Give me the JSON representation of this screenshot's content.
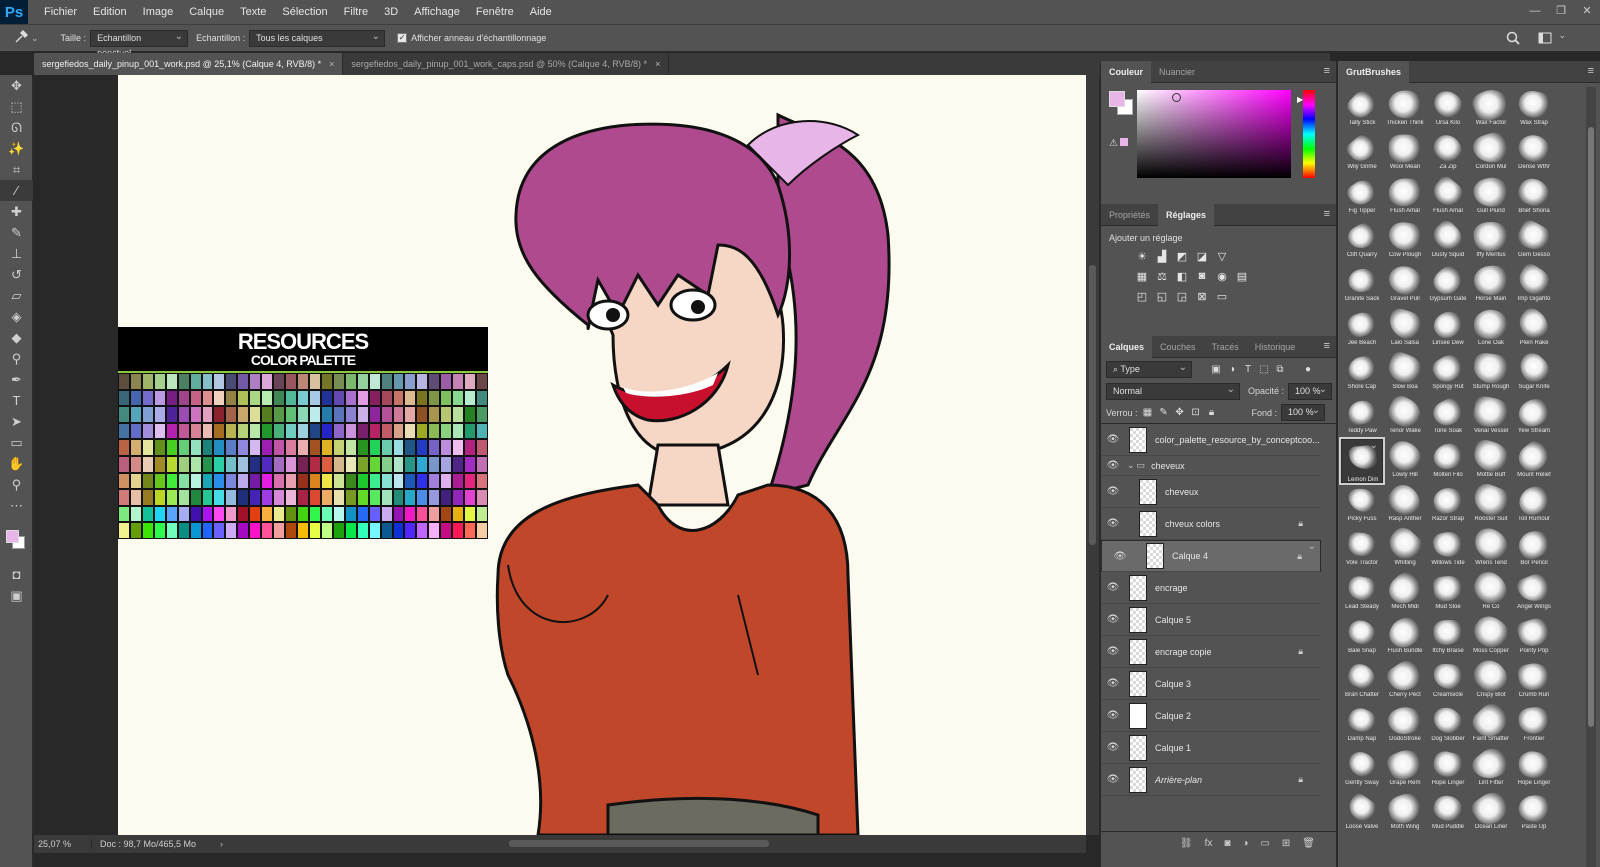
{
  "app": {
    "logo": "Ps"
  },
  "menu": [
    "Fichier",
    "Edition",
    "Image",
    "Calque",
    "Texte",
    "Sélection",
    "Filtre",
    "3D",
    "Affichage",
    "Fenêtre",
    "Aide"
  ],
  "window_controls": [
    "—",
    "❐",
    "✕"
  ],
  "options": {
    "tool_icon": "eyedropper-icon",
    "size_label": "Taille :",
    "size_value": "Echantillon ponctuel",
    "sample_label": "Echantillon :",
    "sample_value": "Tous les calques",
    "ring_checked": true,
    "ring_label": "Afficher anneau d'échantillonnage"
  },
  "tabs": [
    {
      "label": "sergefiedos_daily_pinup_001_work.psd @ 25,1% (Calque 4, RVB/8) *",
      "active": true
    },
    {
      "label": "sergefiedos_daily_pinup_001_work_caps.psd @ 50% (Calque 4, RVB/8) *",
      "active": false
    }
  ],
  "tools": [
    "move",
    "marquee",
    "lasso",
    "wand",
    "crop",
    "eyedropper",
    "heal",
    "brush",
    "stamp",
    "history",
    "eraser",
    "bucket",
    "blur",
    "dodge",
    "pen",
    "type",
    "select",
    "shape",
    "hand",
    "zoom",
    "more"
  ],
  "canvas": {
    "palette_title": "RESOURCES",
    "palette_subtitle": "COLOR PALETTE"
  },
  "status": {
    "zoom": "25,07 %",
    "doc": "Doc : 98,7 Mo/465,5 Mo"
  },
  "color_panel": {
    "tabs": [
      "Couleur",
      "Nuancier"
    ],
    "fg": "#e8b5e8",
    "bg": "#ffffff"
  },
  "adjust_panel": {
    "tabs": [
      "Propriétés",
      "Réglages"
    ],
    "title": "Ajouter un réglage"
  },
  "layers_panel": {
    "tabs": [
      "Calques",
      "Couches",
      "Tracés",
      "Historique"
    ],
    "filter": "Type",
    "blend": "Normal",
    "opacity_label": "Opacité :",
    "opacity": "100 %",
    "lock_label": "Verrou :",
    "fill_label": "Fond :",
    "fill": "100 %",
    "layers": [
      {
        "name": "color_palette_resource_by_conceptcoo...",
        "indent": 0,
        "type": "layer",
        "locked": false,
        "selected": false
      },
      {
        "name": "cheveux",
        "indent": 0,
        "type": "group",
        "locked": false,
        "selected": false
      },
      {
        "name": "cheveux",
        "indent": 1,
        "type": "layer",
        "locked": false,
        "selected": false
      },
      {
        "name": "chveux colors",
        "indent": 1,
        "type": "layer",
        "locked": true,
        "selected": false
      },
      {
        "name": "Calque 4",
        "indent": 1,
        "type": "layer",
        "locked": true,
        "selected": true
      },
      {
        "name": "encrage",
        "indent": 0,
        "type": "layer",
        "locked": false,
        "selected": false
      },
      {
        "name": "Calque 5",
        "indent": 0,
        "type": "layer",
        "locked": false,
        "selected": false
      },
      {
        "name": "encrage copie",
        "indent": 0,
        "type": "layer",
        "locked": true,
        "selected": false
      },
      {
        "name": "Calque 3",
        "indent": 0,
        "type": "layer",
        "locked": false,
        "selected": false
      },
      {
        "name": "Calque 2",
        "indent": 0,
        "type": "layer",
        "locked": false,
        "selected": false,
        "white": true
      },
      {
        "name": "Calque 1",
        "indent": 0,
        "type": "layer",
        "locked": false,
        "selected": false
      },
      {
        "name": "Arrière-plan",
        "indent": 0,
        "type": "layer",
        "locked": true,
        "selected": false,
        "italic": true
      }
    ]
  },
  "brush_panel": {
    "title": "GrutBrushes",
    "brushes": [
      "Tally Stick",
      "Thicken Think",
      "Ursa Kilo",
      "Wax Factor",
      "Wax Strap",
      "Wily Grime",
      "Wool Mean",
      "Za Zip",
      "Cordon Mul",
      "Dense Wthr",
      "Fig Tipper",
      "Flush Amal",
      "Flush Amal",
      "Gull Plund",
      "Brief Shona",
      "Clift Quarry",
      "Cow Plough",
      "Dusty Squid",
      "Iffy Mentus",
      "Gem Gesso",
      "Granite Sack",
      "Gravel Pull",
      "Gypsum Gate",
      "Horse Main",
      "Imp Gigahto",
      "Jee Beach",
      "Lalo Salsa",
      "Linsee Dew",
      "Lone Oak",
      "Plein Rake",
      "Shore Cap",
      "Slow Boa",
      "Spongy Rut",
      "Stump Rough",
      "Sugar Knife",
      "Teddy Paw",
      "Tenor Wake",
      "Tone Soak",
      "Venal Vessel",
      "Yew Stream",
      "Lemon Dim",
      "Lowly Hill",
      "Molten Filo",
      "Mottle Buff",
      "Mount Relief",
      "Picky Fuss",
      "Rasp Anther",
      "Razor Strap",
      "Rooster Suit",
      "Toll Rumour",
      "Vole Tractor",
      "Whitling",
      "Willows Tide",
      "Wrens Tend",
      "Bor Pencil",
      "Lead Steady",
      "Mech Midi",
      "Mud Sloe",
      "Re Co",
      "Angel Wings",
      "Bale Snap",
      "Flush Bundle",
      "Itchy Braise",
      "Moss Copper",
      "Pointy Pop",
      "Bran Chatter",
      "Cherry Pect",
      "Creamsicle",
      "Crispy Blot",
      "Crumb Run",
      "Damp Nap",
      "DodoStroke",
      "Dog Slobber",
      "Faint Smatter",
      "Frontier",
      "Gently Sway",
      "Grape Rem",
      "Hope Linger",
      "Lint Fitter",
      "Hope Linger",
      "Loose Valve",
      "Moth Wing",
      "Mud Puddle",
      "Ocean Liner",
      "Paste Up"
    ],
    "selected_index": 40
  }
}
